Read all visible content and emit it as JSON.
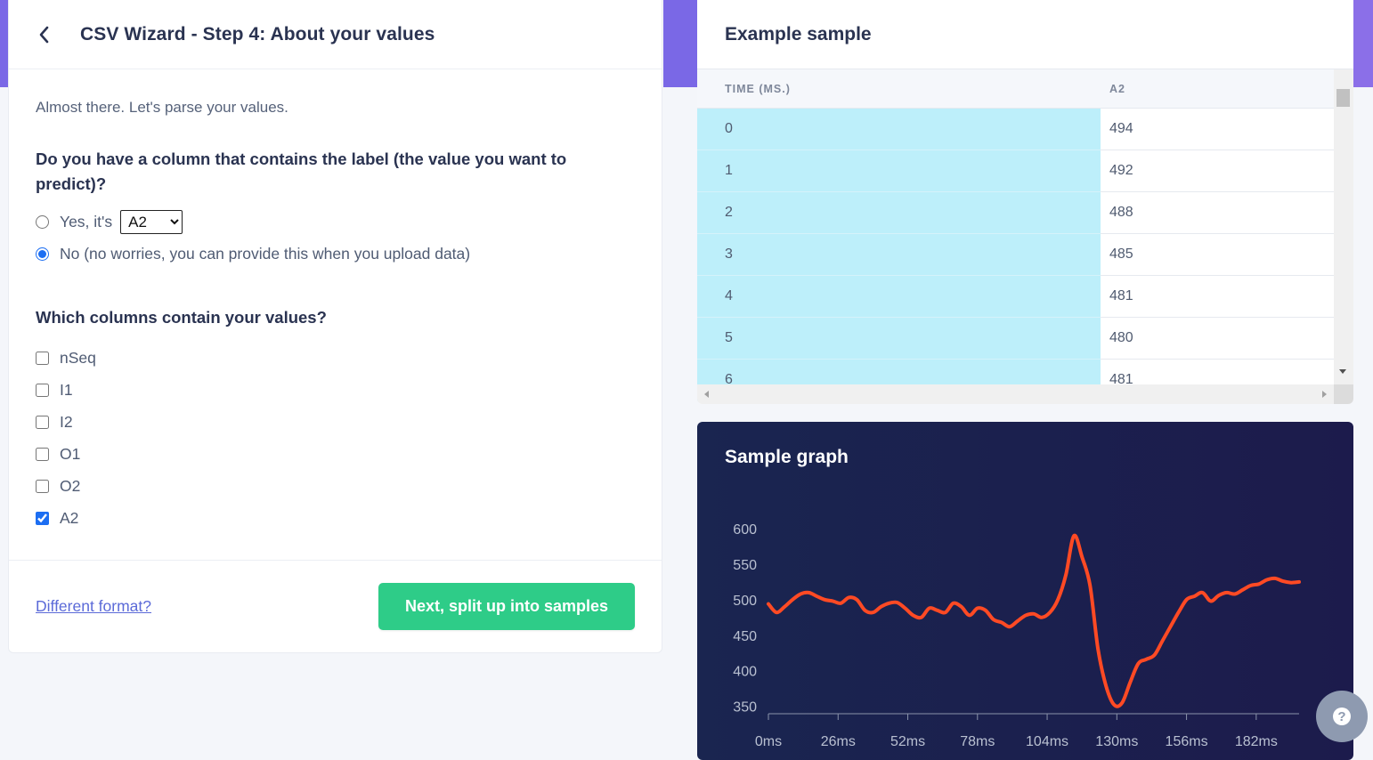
{
  "wizard": {
    "title": "CSV Wizard - Step 4: About your values",
    "intro": "Almost there. Let's parse your values.",
    "label_question": "Do you have a column that contains the label (the value you want to predict)?",
    "yes_label": "Yes, it's",
    "label_select_value": "A2",
    "no_label": "No (no worries, you can provide this when you upload data)",
    "selected_option": "no",
    "values_question": "Which columns contain your values?",
    "columns": [
      {
        "name": "nSeq",
        "checked": false
      },
      {
        "name": "I1",
        "checked": false
      },
      {
        "name": "I2",
        "checked": false
      },
      {
        "name": "O1",
        "checked": false
      },
      {
        "name": "O2",
        "checked": false
      },
      {
        "name": "A2",
        "checked": true
      }
    ],
    "different_format_link": "Different format?",
    "next_button": "Next, split up into samples"
  },
  "sample": {
    "title": "Example sample",
    "headers": [
      "TIME (MS.)",
      "A2"
    ],
    "rows": [
      [
        "0",
        "494"
      ],
      [
        "1",
        "492"
      ],
      [
        "2",
        "488"
      ],
      [
        "3",
        "485"
      ],
      [
        "4",
        "481"
      ],
      [
        "5",
        "480"
      ],
      [
        "6",
        "481"
      ]
    ]
  },
  "graph": {
    "title": "Sample graph",
    "chart_data": {
      "type": "line",
      "title": "Sample graph",
      "xlabel": "",
      "ylabel": "",
      "xlim": [
        0,
        198
      ],
      "ylim": [
        342,
        600
      ],
      "x_ticks": [
        "0ms",
        "26ms",
        "52ms",
        "78ms",
        "104ms",
        "130ms",
        "156ms",
        "182ms"
      ],
      "x_tick_values": [
        0,
        26,
        52,
        78,
        104,
        130,
        156,
        182
      ],
      "y_ticks": [
        600,
        550,
        500,
        450,
        400,
        350
      ],
      "line_color": "#ff4a24",
      "series": [
        {
          "x": [
            0,
            3,
            6,
            9,
            12,
            15,
            18,
            21,
            24,
            27,
            30,
            33,
            36,
            39,
            42,
            45,
            48,
            51,
            54,
            57,
            60,
            63,
            66,
            69,
            72,
            75,
            78,
            81,
            84,
            87,
            90,
            93,
            96,
            99,
            102,
            105,
            108,
            111,
            114,
            117,
            120,
            123,
            126,
            129,
            132,
            135,
            138,
            141,
            144,
            147,
            150,
            153,
            156,
            159,
            162,
            165,
            168,
            171,
            174,
            177,
            180,
            183,
            186,
            189,
            192,
            195,
            198
          ],
          "y": [
            494,
            482,
            490,
            500,
            508,
            510,
            505,
            500,
            498,
            495,
            503,
            500,
            485,
            482,
            490,
            495,
            496,
            488,
            478,
            475,
            488,
            485,
            482,
            495,
            490,
            478,
            488,
            485,
            472,
            468,
            462,
            470,
            478,
            480,
            475,
            482,
            500,
            535,
            590,
            560,
            520,
            430,
            378,
            352,
            355,
            384,
            410,
            416,
            422,
            442,
            462,
            482,
            500,
            505,
            510,
            498,
            506,
            510,
            508,
            514,
            520,
            522,
            528,
            530,
            526,
            524,
            525
          ]
        }
      ]
    }
  },
  "help_icon": "question-circle-icon",
  "colors": {
    "accent": "#7a68e6",
    "primary_button": "#2ecc88",
    "highlight_column": "#bdeffa",
    "graph_bg": "#1a2550",
    "graph_line": "#ff4a24",
    "link": "#5b6ad8"
  }
}
